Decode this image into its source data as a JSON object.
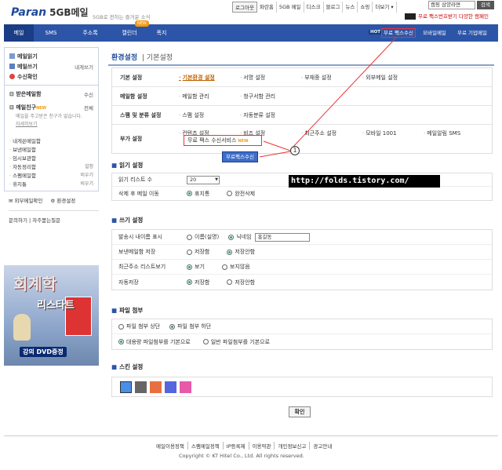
{
  "header": {
    "logo": "Paran",
    "logo_product": "5GB메일",
    "tagline": "5GB로 전하는 즐거운 소식",
    "top_links": [
      "로그아웃",
      "파란홈",
      "5GB 메일",
      "디스크",
      "블로그",
      "뉴스",
      "쇼핑",
      "더보기 ▾"
    ],
    "search_placeholder": "캠핑 삼양라면",
    "search_button": "검색",
    "promo": "무료 팩스번호받기 다양한 캠페인"
  },
  "nav": {
    "tabs": [
      "메일",
      "SMS",
      "주소록",
      "캘린더",
      "폭지"
    ],
    "new_badge": "NEW",
    "hot": "HOT",
    "fax_link": "무료 팩스수신",
    "mobile": "모바일메일",
    "biz": "무료 기업메일"
  },
  "sidebar": {
    "read": "메일읽기",
    "write": "메일쓰기",
    "write_me": "내게쓰기",
    "confirm": "수신확인",
    "inbox": "받은메일함",
    "inbox_action": "수신",
    "friend": "메일친구",
    "friend_new": "NEW",
    "friend_action": "전체",
    "friend_desc": "메일을 주고받은 친구가 없습니다.",
    "friend_link": "자세히보기",
    "folders": [
      {
        "name": "내게쓴메일함",
        "action": ""
      },
      {
        "name": "보낸메일함",
        "action": ""
      },
      {
        "name": "임시보관함",
        "action": ""
      },
      {
        "name": "자동정리함",
        "action": "설정"
      },
      {
        "name": "스팸메일함",
        "action": "비우기"
      },
      {
        "name": "휴지통",
        "action": "비우기"
      }
    ],
    "ext_check": "외부메일확인",
    "settings": "환경설정",
    "help": "문의하기",
    "faq": "자주묻는질문",
    "banner_title": "회계학",
    "banner_sub": "리스타트",
    "banner_cta": "강의 DVD증정"
  },
  "main": {
    "title": "환경설정",
    "subtitle": "기본설정",
    "settings": [
      {
        "category": "기본 설정",
        "items": [
          "기본환경 설정",
          "서명 설정",
          "부재중 설정",
          "외부메일 설정"
        ]
      },
      {
        "category": "메일함 설정",
        "items": [
          "메일함 관리",
          "청구서함 관리"
        ]
      },
      {
        "category": "스팸 및 분류 설정",
        "items": [
          "스팸 설정",
          "자동분류 설정"
        ]
      },
      {
        "category": "부가 설정",
        "items": [
          "컨텐츠 설정",
          "비즈 설정",
          "최근주소 설정",
          "모바일 1001",
          "메일알림 SMS"
        ]
      }
    ],
    "fax_item": "무료 팩스 수신서비스",
    "fax_new": "NEW",
    "fax_button": "무료팩스수신",
    "callout_num": "1",
    "url_overlay": "http://folds.tistory.com/",
    "read_section": "읽기 설정",
    "read_rows": [
      {
        "label": "읽기 리스트 수",
        "select": "20"
      },
      {
        "label": "삭제 후 메일 이동",
        "opt1": "휴지통",
        "opt2": "완전삭제"
      }
    ],
    "write_section": "쓰기 설정",
    "write_rows": [
      {
        "label": "발송시 내이름 표시",
        "opt1": "이름(실명)",
        "opt2": "닉네임",
        "input": "홍길동"
      },
      {
        "label": "보낸메일함 저장",
        "opt1": "저장함",
        "opt2": "저장안함"
      },
      {
        "label": "최근주소 리스트보기",
        "opt1": "보기",
        "opt2": "보지않음"
      },
      {
        "label": "자동저장",
        "opt1": "저장함",
        "opt2": "저장안함"
      }
    ],
    "attach_section": "파일 첨부",
    "attach_row1": {
      "opt1": "파일 첨부 상단",
      "opt2": "파일 첨부 하단"
    },
    "attach_row2": {
      "opt1": "대용량 파일첨부를 기본으로",
      "opt2": "일반 파일첨부를 기본으로"
    },
    "skin_section": "스킨 설정",
    "skins": [
      "#4a8ee8",
      "#666666",
      "#e87040",
      "#5566dd",
      "#e85aa8"
    ],
    "confirm_button": "확인"
  },
  "footer": {
    "links": [
      "메일이용정책",
      "스팸메일정책",
      "IP등록제",
      "이용약관",
      "개인정보신고",
      "광고안내"
    ],
    "copyright": "Copyright © KT Hitel Co., Ltd. All rights reserved."
  }
}
